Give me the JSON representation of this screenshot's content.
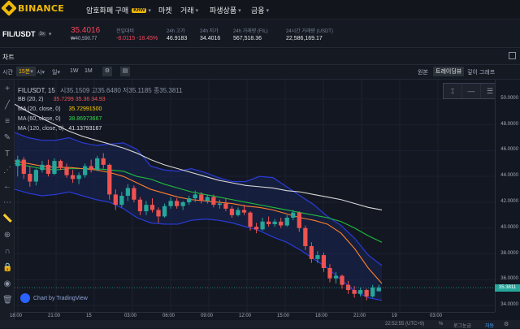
{
  "brand": {
    "name": "BINANCE"
  },
  "nav": {
    "items": [
      {
        "label": "암호화폐 구매",
        "badge": "KRW",
        "caret": true
      },
      {
        "label": "마켓",
        "badge": "",
        "caret": false
      },
      {
        "label": "거래",
        "badge": "",
        "caret": true
      },
      {
        "label": "파생상품",
        "badge": "",
        "caret": true
      },
      {
        "label": "금융",
        "badge": "",
        "caret": true
      }
    ]
  },
  "ticker": {
    "symbol": "FIL/USDT",
    "leverage": "3x",
    "price": "35.4016",
    "price_krw": "₩40,590.77",
    "change_label": "전일대비",
    "change_value": "-8.0115 -18.45%",
    "high_label": "24h 고가",
    "high": "46.9183",
    "low_label": "24h 저가",
    "low": "34.4016",
    "vol_fil_label": "24h 거래량 (FIL)",
    "vol_fil": "567,518.36",
    "vol_usdt_label": "24시간 거래량 (USDT)",
    "vol_usdt": "22,586,169.17"
  },
  "chart_header": {
    "title": "차트"
  },
  "toolbar": {
    "time_label": "시간",
    "interval": "15분",
    "hour": "시",
    "day": "일",
    "week": "1W",
    "month": "1M",
    "view_original": "원본",
    "view_tradingview": "트레이딩뷰",
    "view_depth": "깊이 그래프"
  },
  "legend": {
    "title_line": "FILUSDT, 15",
    "ohlc": "시35.1509 고35.6480 저35.1185 종35.3811",
    "bb": {
      "label": "BB (20, 2)",
      "values": "35.7299  35.36  34.93"
    },
    "ma20": {
      "label": "MA (20, close, 0)",
      "value": "35.72991500"
    },
    "ma60": {
      "label": "MA (60, close, 0)",
      "value": "38.86973667"
    },
    "ma120": {
      "label": "MA (120, close, 0)",
      "value": "41.13793167"
    }
  },
  "colors": {
    "up": "#26a69a",
    "down": "#ef5350",
    "bb": "#2b3bd9",
    "ma20": "#ff7f2a",
    "ma60": "#1fbf3a",
    "ma120": "#d8d8d8",
    "accent": "#f0b90b",
    "ma20_text": "#ffd000",
    "ma60_text": "#34d84a"
  },
  "price_label": "35.3811",
  "yaxis": {
    "ticks": [
      "50.0000",
      "48.0000",
      "46.0000",
      "44.0000",
      "42.0000",
      "40.0000",
      "38.0000",
      "36.0000",
      "34.0000"
    ]
  },
  "xaxis": {
    "ticks": [
      "18:00",
      "21:00",
      "15",
      "03:00",
      "06:00",
      "09:00",
      "12:00",
      "15:00",
      "18:00",
      "21:00",
      "19",
      "03:00"
    ]
  },
  "watermark": "Chart by TradingView",
  "status": {
    "time": "22:52:55 (UTC+9)",
    "percent": "%",
    "log": "로그눈금",
    "auto": "자동"
  },
  "chart_data": {
    "type": "line",
    "candle_type": "candlestick",
    "ylim": [
      33.5,
      51.5
    ],
    "candles": [
      [
        44.8,
        45.6,
        44.0,
        45.3
      ],
      [
        45.3,
        45.5,
        43.8,
        44.2
      ],
      [
        44.2,
        44.8,
        43.2,
        43.6
      ],
      [
        43.6,
        44.6,
        43.3,
        44.5
      ],
      [
        44.5,
        45.2,
        44.3,
        44.9
      ],
      [
        44.9,
        45.3,
        44.0,
        44.2
      ],
      [
        44.2,
        45.4,
        44.1,
        45.2
      ],
      [
        45.2,
        45.3,
        44.5,
        44.7
      ],
      [
        44.7,
        45.0,
        43.9,
        44.1
      ],
      [
        44.1,
        44.5,
        43.5,
        43.8
      ],
      [
        43.8,
        44.3,
        43.4,
        44.1
      ],
      [
        44.1,
        45.0,
        43.9,
        44.8
      ],
      [
        44.8,
        45.3,
        44.3,
        44.5
      ],
      [
        44.5,
        45.6,
        44.4,
        45.4
      ],
      [
        45.4,
        45.8,
        44.6,
        44.9
      ],
      [
        44.9,
        45.0,
        42.2,
        42.6
      ],
      [
        42.6,
        43.0,
        41.4,
        41.8
      ],
      [
        41.8,
        42.8,
        41.6,
        42.5
      ],
      [
        42.5,
        43.4,
        42.1,
        43.1
      ],
      [
        43.1,
        43.3,
        42.0,
        42.2
      ],
      [
        42.2,
        42.4,
        41.0,
        41.3
      ],
      [
        41.3,
        42.1,
        41.0,
        41.8
      ],
      [
        41.8,
        42.3,
        41.2,
        41.4
      ],
      [
        41.4,
        41.6,
        40.4,
        40.9
      ],
      [
        40.9,
        41.9,
        40.8,
        41.7
      ],
      [
        41.7,
        42.4,
        41.5,
        42.1
      ],
      [
        42.1,
        42.3,
        41.5,
        41.7
      ],
      [
        41.7,
        42.1,
        41.4,
        42.0
      ],
      [
        42.0,
        42.5,
        41.8,
        42.3
      ],
      [
        42.3,
        42.9,
        42.0,
        42.6
      ],
      [
        42.6,
        42.8,
        41.9,
        42.1
      ],
      [
        42.1,
        42.6,
        41.9,
        42.4
      ],
      [
        42.4,
        42.6,
        41.6,
        41.8
      ],
      [
        41.8,
        42.2,
        41.5,
        41.9
      ],
      [
        41.9,
        42.3,
        41.3,
        41.5
      ],
      [
        41.5,
        41.7,
        40.8,
        41.0
      ],
      [
        41.0,
        41.6,
        40.9,
        41.4
      ],
      [
        41.4,
        41.8,
        41.0,
        41.2
      ],
      [
        41.2,
        41.3,
        39.8,
        40.1
      ],
      [
        40.1,
        40.4,
        39.6,
        39.9
      ],
      [
        39.9,
        40.8,
        39.8,
        40.5
      ],
      [
        40.5,
        40.9,
        40.1,
        40.3
      ],
      [
        40.3,
        40.7,
        40.1,
        40.5
      ],
      [
        40.5,
        40.8,
        40.0,
        40.2
      ],
      [
        40.2,
        41.0,
        40.1,
        40.8
      ],
      [
        40.8,
        41.4,
        40.6,
        41.2
      ],
      [
        41.2,
        41.3,
        39.7,
        40.0
      ],
      [
        40.0,
        40.2,
        38.3,
        38.6
      ],
      [
        38.6,
        38.9,
        37.3,
        37.6
      ],
      [
        37.6,
        38.2,
        37.3,
        37.9
      ],
      [
        37.9,
        38.1,
        36.6,
        36.9
      ],
      [
        36.9,
        37.2,
        35.8,
        36.1
      ],
      [
        36.1,
        36.6,
        35.7,
        36.3
      ],
      [
        36.3,
        36.4,
        35.3,
        35.6
      ],
      [
        35.6,
        35.9,
        34.9,
        35.2
      ],
      [
        35.2,
        35.5,
        34.6,
        34.9
      ],
      [
        34.9,
        35.4,
        34.7,
        35.2
      ],
      [
        35.2,
        35.3,
        34.4,
        34.7
      ],
      [
        34.7,
        35.6,
        34.6,
        35.4
      ],
      [
        35.1,
        35.6,
        35.1,
        35.4
      ]
    ],
    "bb_upper": [
      47.4,
      47.0,
      46.8,
      46.8,
      47.0,
      46.6,
      46.4,
      46.5,
      46.6,
      46.1,
      44.8,
      44.5,
      44.4,
      44.6,
      44.3,
      43.9,
      43.6,
      43.6,
      44.0,
      43.9,
      43.2,
      42.5,
      41.8,
      40.9,
      40.2,
      39.2,
      37.9,
      37.1
    ],
    "bb_lower": [
      43.0,
      42.7,
      42.5,
      42.6,
      42.8,
      42.5,
      42.2,
      42.0,
      41.5,
      40.8,
      40.4,
      40.3,
      40.3,
      40.6,
      40.7,
      40.6,
      40.4,
      40.1,
      39.8,
      39.3,
      38.9,
      38.3,
      37.6,
      36.9,
      36.0,
      35.1,
      34.6,
      34.4
    ],
    "ma20": [
      45.2,
      45.0,
      44.8,
      44.7,
      44.7,
      44.6,
      44.5,
      44.3,
      44.0,
      43.5,
      43.0,
      42.7,
      42.4,
      42.2,
      42.1,
      42.0,
      41.9,
      41.7,
      41.6,
      41.4,
      41.1,
      40.8,
      40.6,
      40.3,
      39.6,
      38.4,
      36.9,
      35.7
    ],
    "ma60": [
      45.0,
      44.8,
      44.6,
      44.5,
      44.6,
      44.6,
      44.6,
      44.5,
      44.4,
      44.0,
      43.8,
      43.4,
      43.1,
      42.8,
      42.6,
      42.4,
      42.2,
      42.0,
      41.8,
      41.6,
      41.4,
      41.2,
      41.0,
      40.8,
      40.5,
      40.0,
      39.4,
      38.9
    ],
    "ma120": [
      49.6,
      49.0,
      48.5,
      48.0,
      47.5,
      47.1,
      46.8,
      46.5,
      46.2,
      45.8,
      45.3,
      44.9,
      44.6,
      44.3,
      44.0,
      43.7,
      43.5,
      43.3,
      43.2,
      43.1,
      42.9,
      42.8,
      42.6,
      42.4,
      42.2,
      41.9,
      41.6,
      41.4
    ]
  }
}
